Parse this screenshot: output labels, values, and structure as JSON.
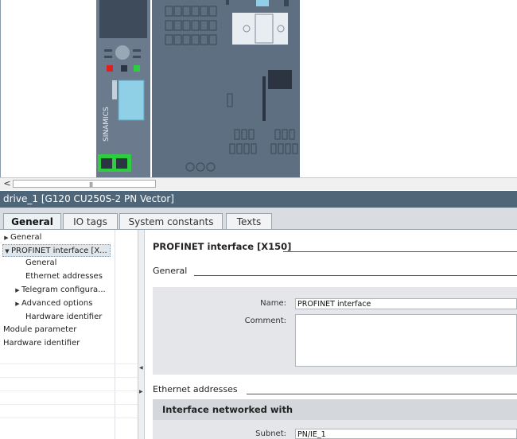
{
  "device": {
    "brand_label": "SINAMICS"
  },
  "scrollbar": {
    "left_arrow": "<",
    "grip": "III"
  },
  "inspector": {
    "title": "drive_1 [G120 CU250S-2 PN Vector]",
    "tabs": [
      {
        "label": "General",
        "active": true
      },
      {
        "label": "IO tags",
        "active": false
      },
      {
        "label": "System constants",
        "active": false
      },
      {
        "label": "Texts",
        "active": false
      }
    ]
  },
  "nav": {
    "items": [
      {
        "label": "General",
        "expander": "collapsed",
        "level": 0
      },
      {
        "label": "PROFINET interface [X...",
        "expander": "expanded",
        "level": 0,
        "selected": true
      },
      {
        "label": "General",
        "expander": "none",
        "level": 1
      },
      {
        "label": "Ethernet addresses",
        "expander": "none",
        "level": 1
      },
      {
        "label": "Telegram configura...",
        "expander": "collapsed",
        "level": 1
      },
      {
        "label": "Advanced options",
        "expander": "collapsed",
        "level": 1
      },
      {
        "label": "Hardware identifier",
        "expander": "none",
        "level": 1
      },
      {
        "label": "Module parameter",
        "expander": "none",
        "level": 0
      },
      {
        "label": "Hardware identifier",
        "expander": "none",
        "level": 0
      }
    ]
  },
  "content": {
    "section_title": "PROFINET interface [X150]",
    "general_heading": "General",
    "name_label": "Name:",
    "name_value": "PROFINET interface",
    "comment_label": "Comment:",
    "comment_value": "",
    "ethernet_heading": "Ethernet addresses",
    "networked_title": "Interface networked with",
    "subnet_label": "Subnet:",
    "subnet_value": "PN/IE_1"
  },
  "colors": {
    "title_bar": "#4f6578",
    "led_red": "#e02020",
    "led_green": "#2ecc40",
    "device_body": "#5f6f82"
  }
}
